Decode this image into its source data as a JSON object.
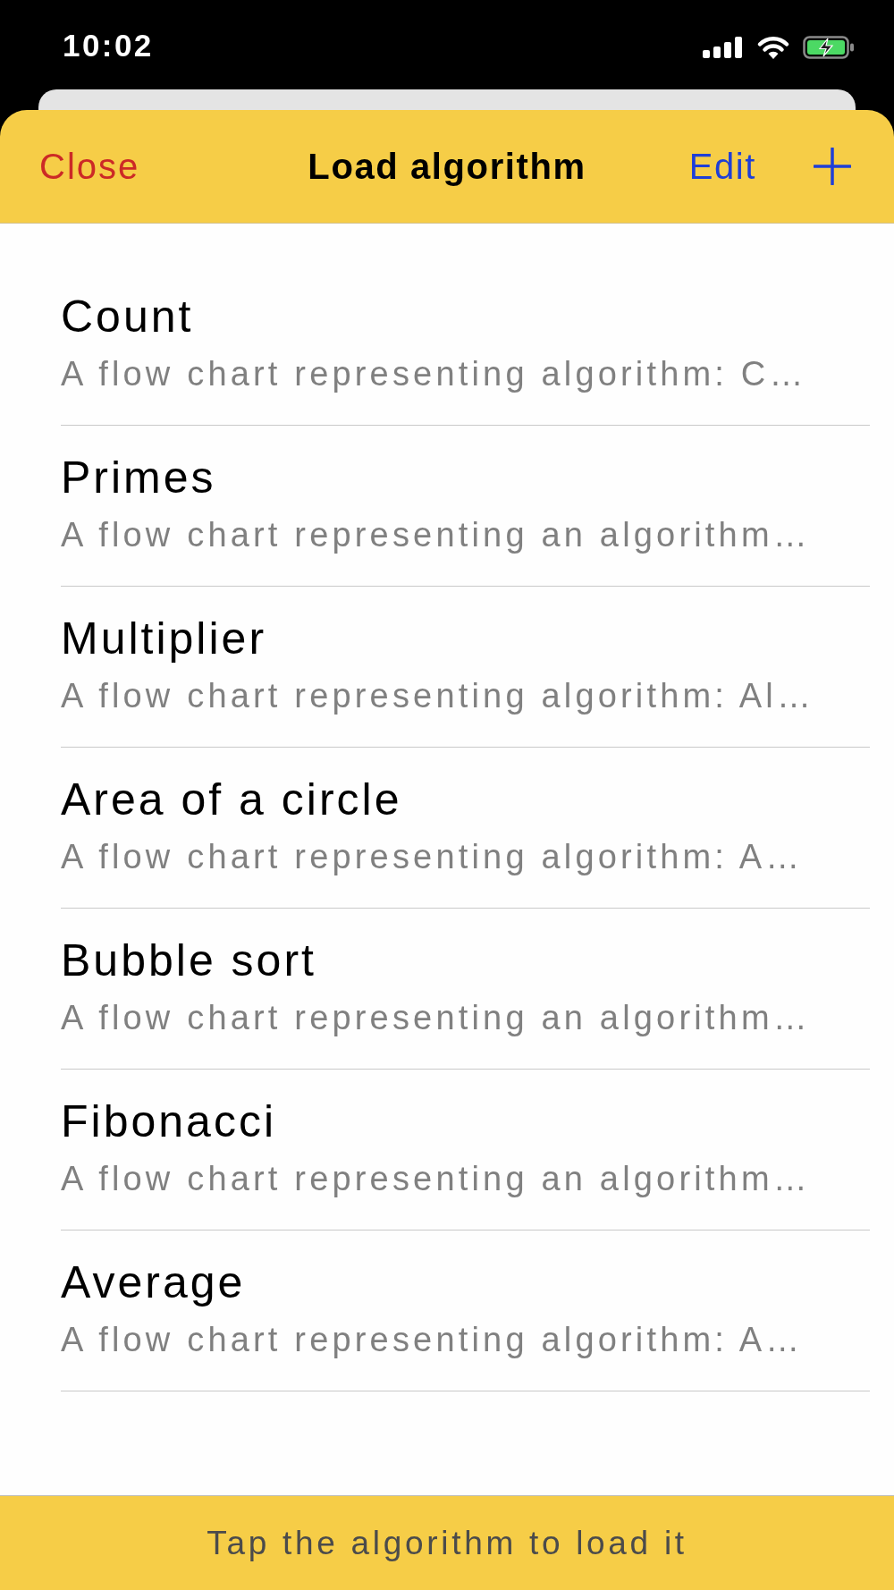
{
  "status_bar": {
    "time": "10:02"
  },
  "navigation_bar": {
    "close": "Close",
    "title": "Load algorithm",
    "edit": "Edit"
  },
  "algorithms": [
    {
      "name": "Count",
      "description": "A flow chart representing algorithm: C…"
    },
    {
      "name": "Primes",
      "description": "A flow chart representing an algorithm…"
    },
    {
      "name": "Multiplier",
      "description": "A flow chart representing algorithm: Al…"
    },
    {
      "name": "Area of a circle",
      "description": "A flow chart representing algorithm: A…"
    },
    {
      "name": "Bubble sort",
      "description": "A flow chart representing an algorithm…"
    },
    {
      "name": "Fibonacci",
      "description": "A flow chart representing an algorithm…"
    },
    {
      "name": "Average",
      "description": "A flow chart representing algorithm: A…"
    }
  ],
  "footer": {
    "hint": "Tap the algorithm to load it"
  }
}
